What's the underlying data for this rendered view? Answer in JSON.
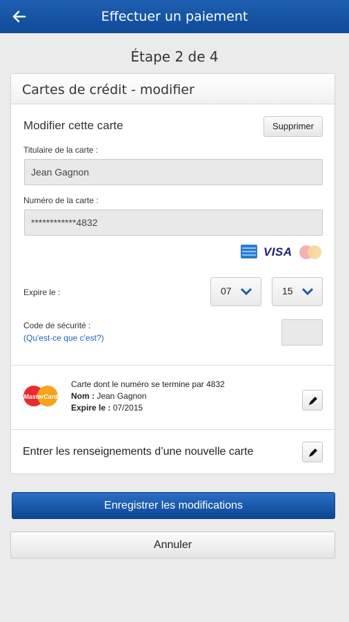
{
  "header": {
    "title": "Effectuer un paiement"
  },
  "step": "Étape 2 de 4",
  "panel": {
    "title": "Cartes de crédit - modifier",
    "section_title": "Modifier cette carte",
    "delete_label": "Supprimer",
    "holder_label": "Titulaire de la carte :",
    "holder_value": "Jean Gagnon",
    "number_label": "Numéro de la carte :",
    "number_value": "************4832",
    "card_brands": {
      "visa": "VISA",
      "colors": {
        "amex": "#2b7ccd",
        "visa": "#1a1f71",
        "mc_red": "#eb2a2e",
        "mc_yellow": "#f7a21b"
      }
    },
    "expiry_label": "Expire le :",
    "expiry_month": "07",
    "expiry_year": "15",
    "cvv_label": "Code de sécurité :",
    "cvv_help": "(Qu'est-ce que c'est?)",
    "saved_card": {
      "logo_text": "MasterCard",
      "line1_prefix": "Carte",
      "line1_rest": " dont le numéro se termine par 4832",
      "line2_prefix": "Nom :",
      "line2_rest": " Jean Gagnon",
      "line3_prefix": "Expire le :",
      "line3_rest": " 07/2015"
    },
    "new_card_label": "Entrer les renseignements d’une nouvelle carte"
  },
  "actions": {
    "save_label": "Enregistrer les modifications",
    "cancel_label": "Annuler"
  },
  "colors": {
    "brand": "#0e4a98",
    "link": "#1c63b7",
    "select_chevron": "#1b5aa5"
  }
}
